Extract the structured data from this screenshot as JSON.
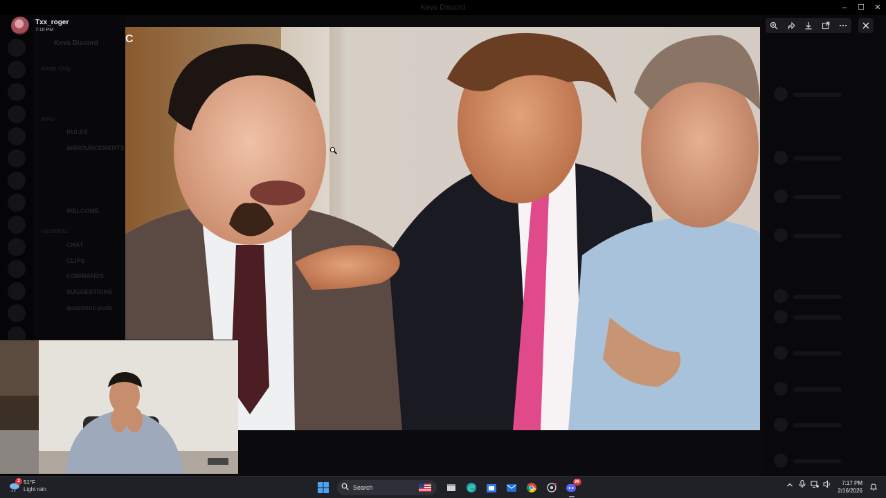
{
  "window": {
    "title": "Kevs Discord",
    "controls": [
      "–",
      "☐",
      "✕"
    ]
  },
  "background_app": {
    "server_name": "Kevs Discord",
    "sub_label": "Invite Only",
    "categories": [
      "INFO",
      "GENERAL"
    ],
    "channels": [
      "RULES",
      "ANNOUNCEMENTS",
      "WELCOME",
      "CHAT",
      "CLIPS",
      "COMMANDS",
      "SUGGESTIONS",
      "questions-polls"
    ]
  },
  "viewer": {
    "uploader_name": "Txx_roger",
    "uploader_time": "7:10 PM",
    "tools": {
      "zoom_icon": "zoom-in-icon",
      "forward_icon": "forward-icon",
      "download_icon": "download-icon",
      "open_icon": "open-external-icon",
      "more_icon": "more-icon",
      "close_icon": "close-icon"
    },
    "watermark": "C"
  },
  "taskbar": {
    "weather": {
      "temp": "51°F",
      "condition": "Light rain",
      "badge": "2"
    },
    "search_placeholder": "Search",
    "apps": [
      "start-icon",
      "task-view-icon",
      "edge-icon",
      "store-icon",
      "mail-icon",
      "chrome-icon",
      "settings-icon",
      "discord-icon"
    ],
    "discord_badge": "99",
    "clock_time": "7:17 PM",
    "clock_date": "2/16/2026"
  },
  "colors": {
    "taskbar_bg": "#1f2127",
    "accent_blue": "#2f7de1",
    "discord_blurple": "#5865f2",
    "badge_red": "#e0323c"
  }
}
